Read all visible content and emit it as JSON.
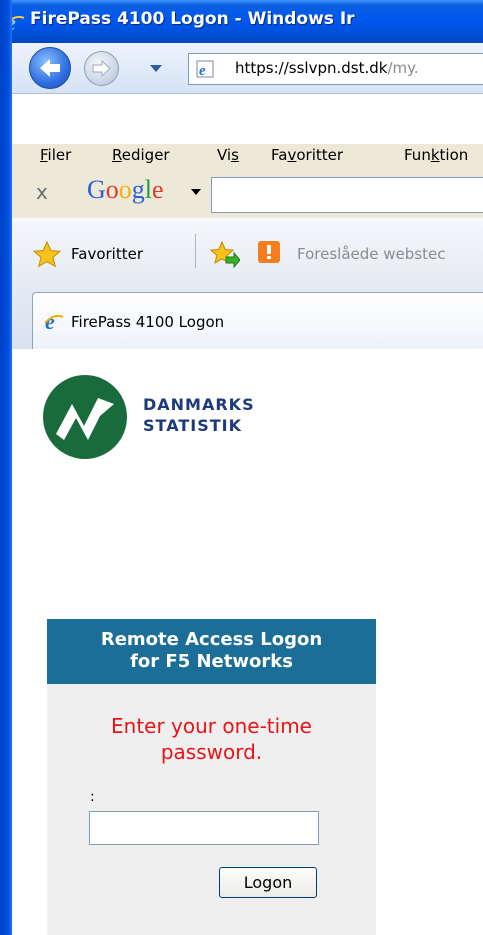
{
  "window": {
    "title": "FirePass 4100 Logon - Windows Ir",
    "titlebar_color": "#0054e3"
  },
  "navigation": {
    "url_prefix": "https://",
    "url_host": "sslvpn.dst.dk",
    "url_dim_path": "/my."
  },
  "menu": {
    "items": [
      {
        "underline": "F",
        "rest": "iler"
      },
      {
        "underline": "R",
        "rest": "ediger"
      },
      {
        "pre": "Vi",
        "underline": "s",
        "rest": ""
      },
      {
        "pre": "Fa",
        "underline": "v",
        "rest": "oritter"
      },
      {
        "pre": "Fun",
        "underline": "k",
        "rest": "tion"
      }
    ]
  },
  "google_toolbar": {
    "close_label": "x",
    "brand": "Google",
    "search_value": ""
  },
  "favorites_bar": {
    "favorites_label": "Favoritter",
    "suggested_sites_label": "Foreslåede webstec"
  },
  "tab": {
    "title": "FirePass 4100 Logon"
  },
  "page": {
    "brand_line1": "DANMARKS",
    "brand_line2": "STATISTIK",
    "brand_color": "#1d3a7a",
    "logo_color": "#1a6b3c",
    "login_header_line1": "Remote Access Logon",
    "login_header_line2": "for F5 Networks",
    "login_header_color": "#1a6e97",
    "prompt_line1": "Enter your one-time",
    "prompt_line2": "password.",
    "prompt_color": "#e8141a",
    "field_label": ":",
    "otp_value": "",
    "logon_button": "Logon"
  }
}
